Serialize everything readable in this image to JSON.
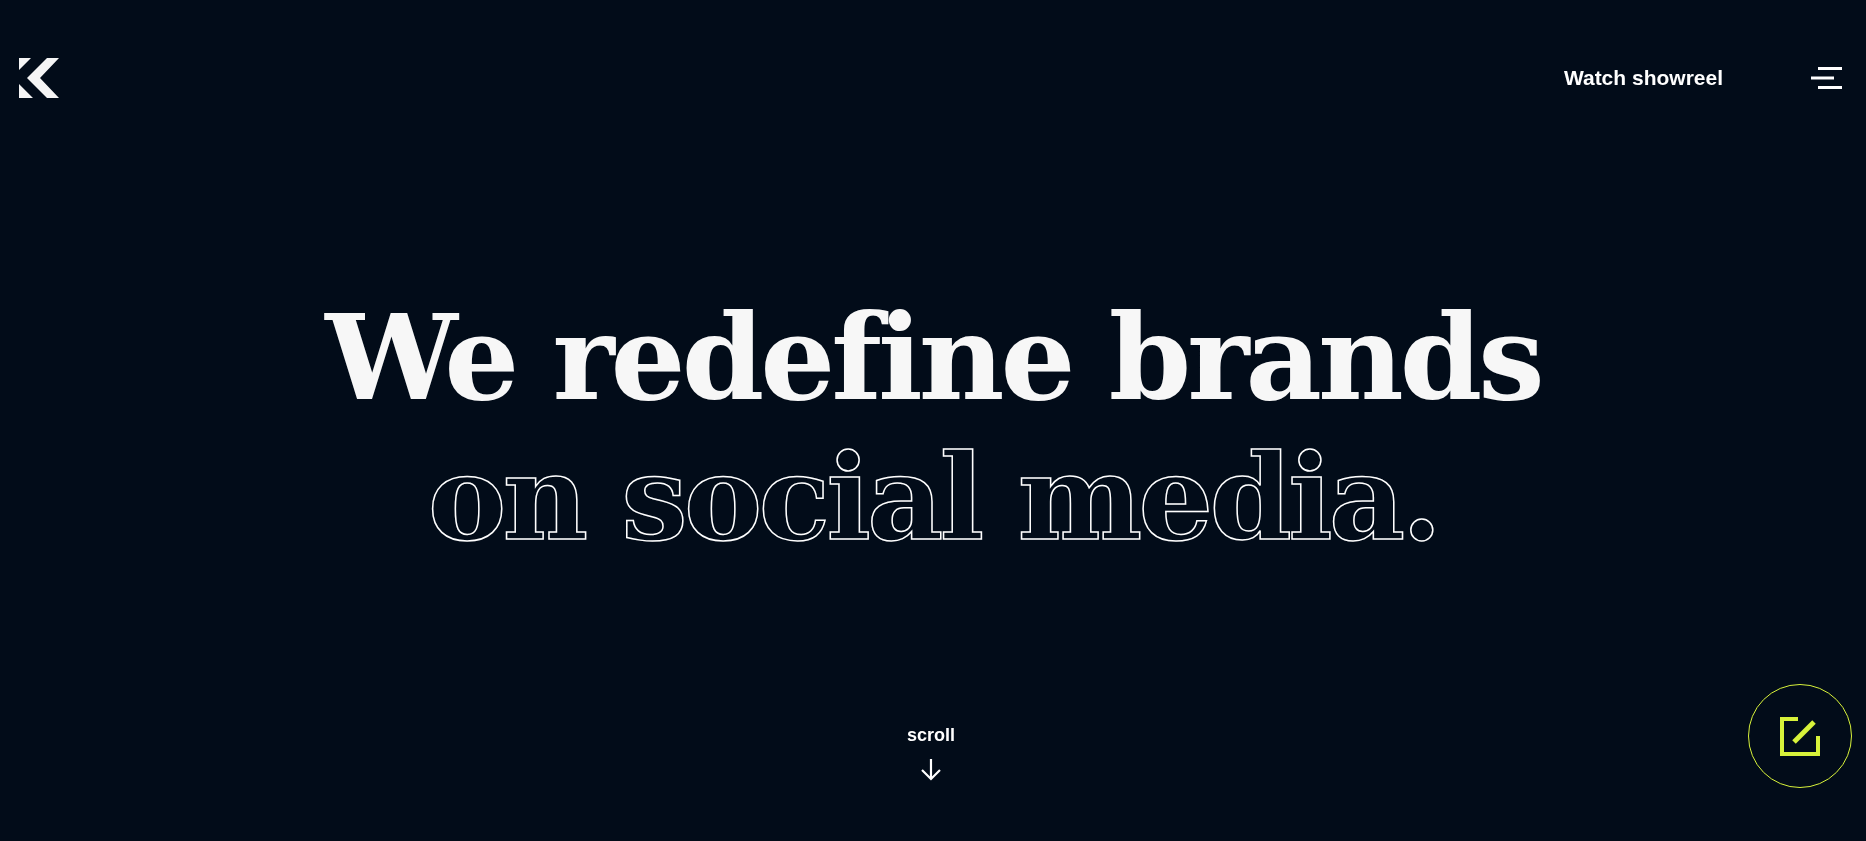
{
  "header": {
    "showreel_link": "Watch showreel"
  },
  "hero": {
    "headline_line_1": "We redefine brands",
    "headline_line_2": "on social media."
  },
  "scroll_hint": {
    "label": "scroll"
  }
}
